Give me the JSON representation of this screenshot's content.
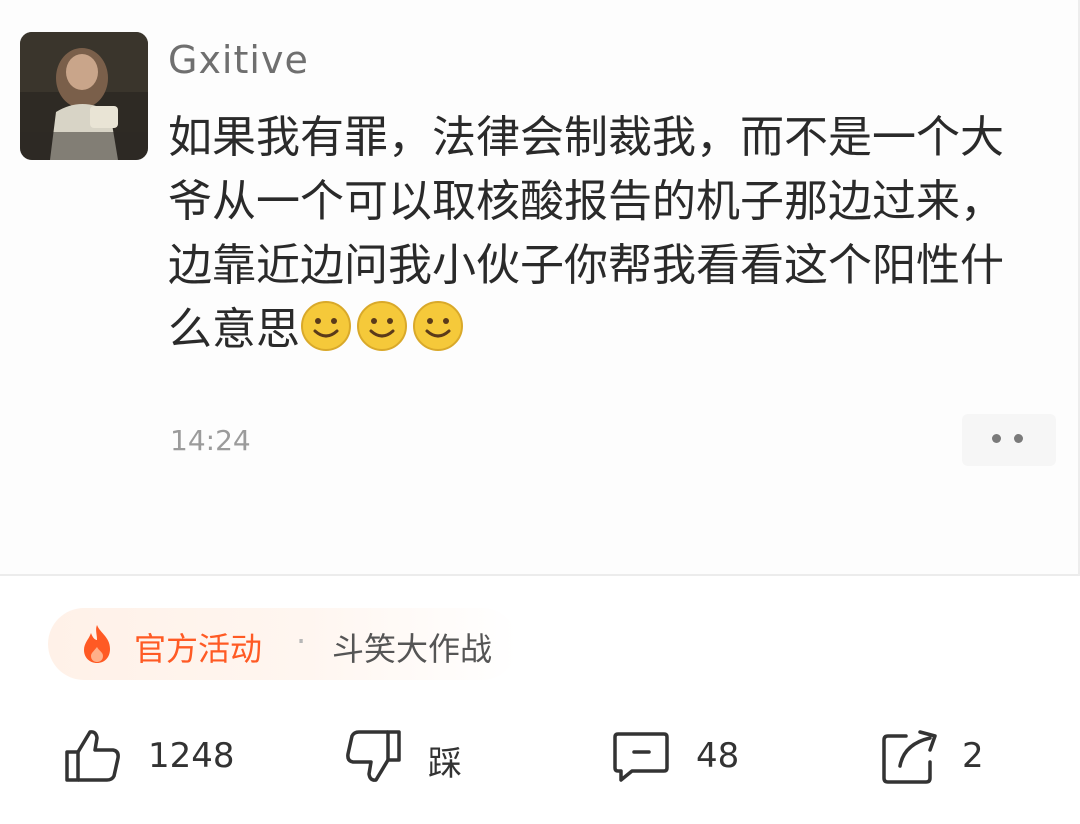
{
  "post": {
    "username": "Gxitive",
    "message": "如果我有罪，法律会制裁我，而不是一个大爷从一个可以取核酸报告的机子那边过来，边靠近边问我小伙子你帮我看看这个阳性什么意思",
    "emoji": [
      "smile-emoji",
      "smile-emoji",
      "smile-emoji"
    ],
    "time": "14:24",
    "more_icon": "more-dots-icon"
  },
  "activity": {
    "icon": "fire-icon",
    "label": "官方活动",
    "separator": "·",
    "title": "斗笑大作战"
  },
  "actions": {
    "like_count": "1248",
    "dislike_label": "踩",
    "comment_count": "48",
    "share_count": "2"
  },
  "colors": {
    "accent": "#ff5a24",
    "emoji_yellow": "#f5c93a"
  }
}
